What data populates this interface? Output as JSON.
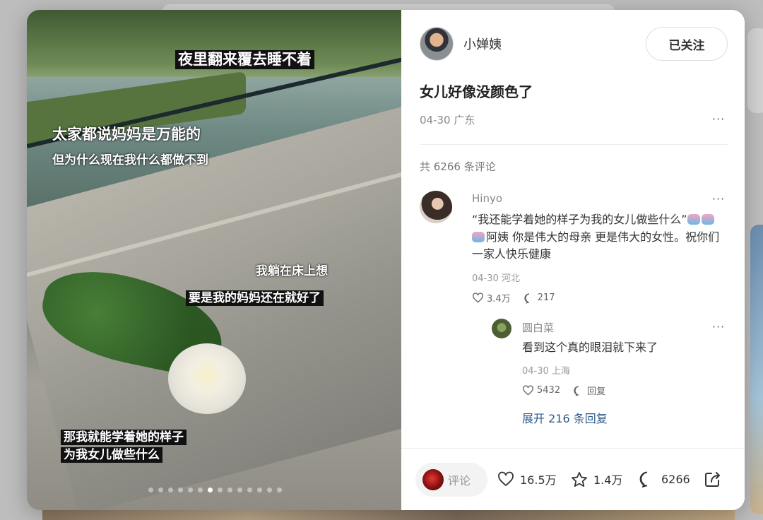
{
  "post": {
    "image_captions": [
      "夜里翻来覆去睡不着",
      "太家都说妈妈是万能的",
      "但为什么现在我什么都做不到",
      "我躺在床上想",
      "要是我的妈妈还在就好了",
      "那我就能学着她的样子",
      "为我女儿做些什么"
    ],
    "author": "小婵姨",
    "follow_label": "已关注",
    "title": "女儿好像没颜色了",
    "date_location": "04-30 广东",
    "more": "···",
    "comment_count": "共 6266 条评论"
  },
  "comments": [
    {
      "name": "Hinyo",
      "text_line1": "“我还能学着她的样子为我的女儿做些什么”",
      "text_line2": "阿姨 你是伟大的母亲 更是伟大的女性。祝你们",
      "text_line3": "一家人快乐健康",
      "meta": "04-30 河北",
      "likes": "3.4万",
      "replies": "217"
    }
  ],
  "reply": {
    "name": "圆白菜",
    "text": "看到这个真的眼泪就下来了",
    "meta": "04-30 上海",
    "likes": "5432",
    "reply_label": "回复",
    "expand": "展开 216 条回复"
  },
  "bottom": {
    "comment_placeholder": "评论",
    "likes": "16.5万",
    "stars": "1.4万",
    "comments": "6266"
  },
  "carousel": {
    "total": 14,
    "current": 6
  }
}
